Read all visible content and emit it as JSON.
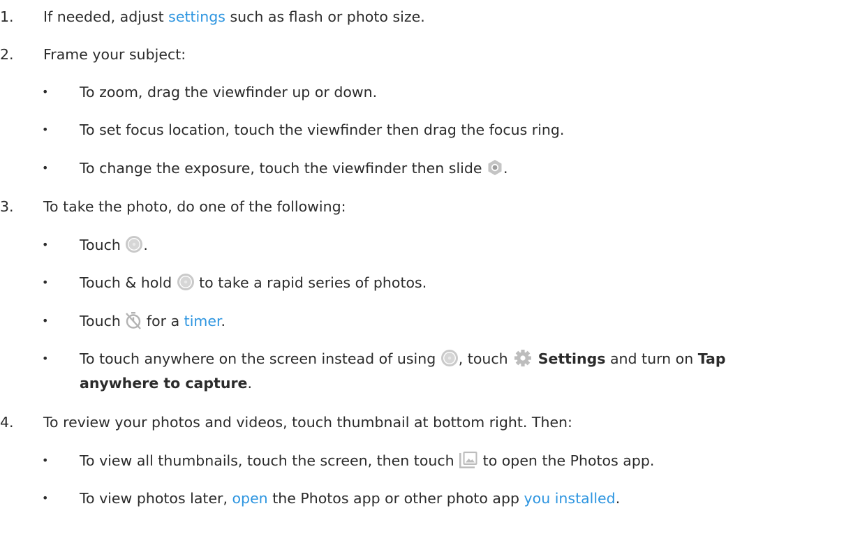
{
  "steps": [
    {
      "number": "1.",
      "text_before": "If needed, adjust ",
      "link": "settings",
      "text_after": " such as flash or photo size."
    },
    {
      "number": "2.",
      "text": "Frame your subject:"
    },
    {
      "number": "3.",
      "text": "To take the photo, do one of the following:"
    },
    {
      "number": "4.",
      "text": "To review your photos and videos, touch thumbnail at bottom right. Then:"
    }
  ],
  "frame_bullets": {
    "zoom": "To zoom, drag the viewfinder up or down.",
    "focus": "To set focus location, touch the viewfinder then drag the focus ring.",
    "exposure_before": "To change the exposure, touch the viewfinder then slide ",
    "exposure_after": "."
  },
  "capture_bullets": {
    "touch_before": "Touch ",
    "touch_after": ".",
    "hold_before": "Touch & hold ",
    "hold_after": " to take a rapid series of photos.",
    "timer_before": "Touch ",
    "timer_middle": " for a ",
    "timer_link": "timer",
    "timer_after": ".",
    "tap_before": "To touch anywhere on the screen instead of using ",
    "tap_middle": ", touch ",
    "tap_settings": "Settings",
    "tap_and": " and turn on ",
    "tap_bold_1": "Tap",
    "tap_bold_2": "anywhere to capture",
    "tap_after": "."
  },
  "review_bullets": {
    "thumbs_before": "To view all thumbnails, touch the screen, then touch ",
    "thumbs_after": " to open the Photos app.",
    "later_before": "To view photos later, ",
    "later_link1": "open",
    "later_middle": " the Photos app or other photo app ",
    "later_link2": "you installed",
    "later_after": "."
  },
  "bullet_char": "•",
  "icons": {
    "exposure": "exposure-icon",
    "shutter": "shutter-button-icon",
    "timer": "timer-icon",
    "settings": "gear-icon",
    "photos": "photos-app-icon"
  },
  "colors": {
    "link": "#2d95e0",
    "text": "#2b2b2b",
    "icon_gray": "#b9b9b9"
  }
}
